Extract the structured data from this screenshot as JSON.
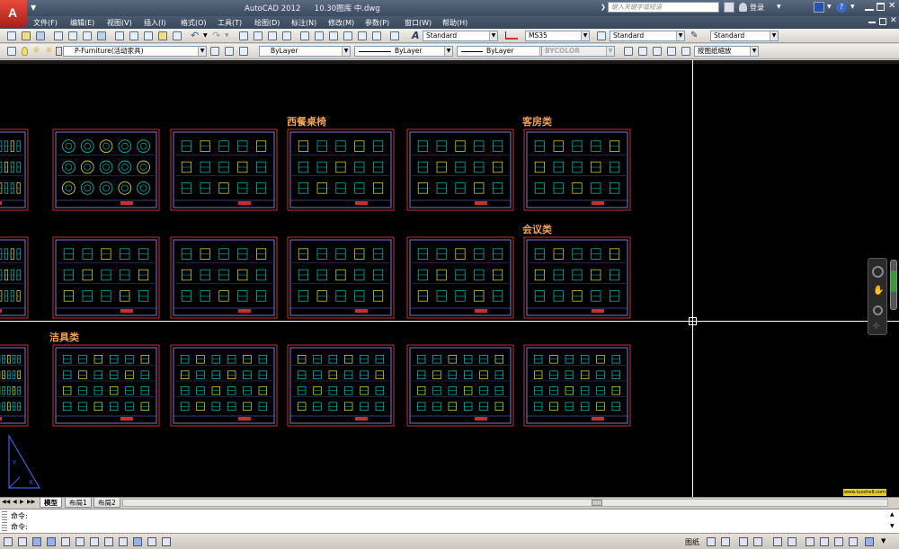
{
  "app": {
    "title": "AutoCAD 2012",
    "document": "10.30图库 中.dwg",
    "search_placeholder": "键入关键字或短语",
    "login_label": "登录",
    "logo_letter": "A",
    "badge": "74"
  },
  "menu": [
    "文件(F)",
    "编辑(E)",
    "视图(V)",
    "插入(I)",
    "格式(O)",
    "工具(T)",
    "绘图(D)",
    "标注(N)",
    "修改(M)",
    "参数(P)",
    "窗口(W)",
    "帮助(H)"
  ],
  "styles": {
    "text_style": "Standard",
    "dim_style": "MS35",
    "table_style": "Standard",
    "multileader_style": "Standard"
  },
  "layers": {
    "current_layer": "P-Furniture(活动家具)",
    "color": "ByLayer",
    "linetype": "ByLayer",
    "lineweight": "ByLayer",
    "plotstyle": "BYCOLOR",
    "viewport_scale": "按图纸缩放"
  },
  "canvas": {
    "labels": [
      "西餐桌椅",
      "客房类",
      "会议类",
      "洁具类"
    ],
    "watermark": "www.tuozhe8.com"
  },
  "tabs": [
    "模型",
    "布局1",
    "布局2"
  ],
  "command": {
    "line1": "命令:",
    "line2": "命令:"
  },
  "status": {
    "paper_label": "图纸"
  },
  "colors": {
    "canvas_bg": "#000000",
    "sheet_border": "#7a7ad8",
    "symbol_cyan": "#00c8c8",
    "symbol_yellow": "#e8e830",
    "frame_red": "#c83030",
    "label_orange": "#f0a050"
  }
}
